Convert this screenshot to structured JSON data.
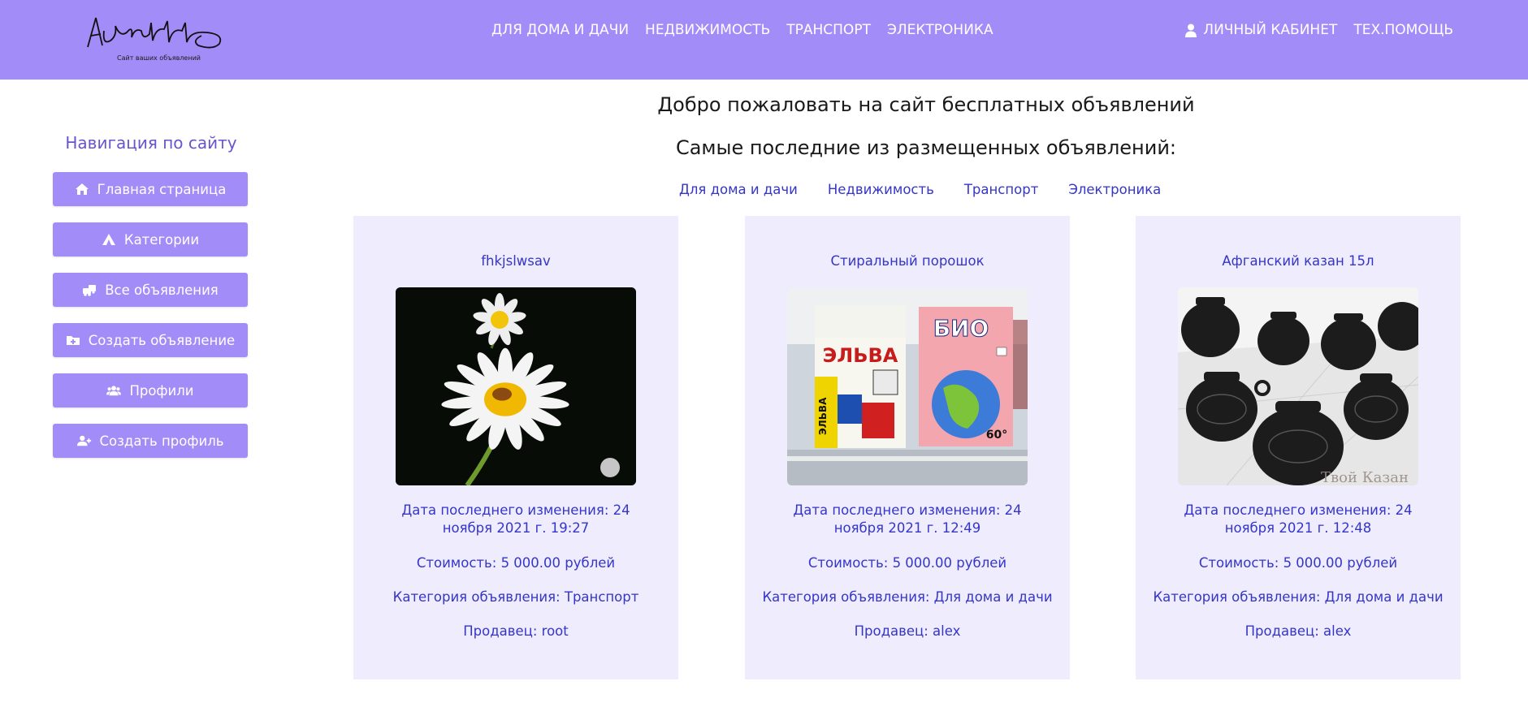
{
  "header": {
    "logo_text": "Avito",
    "logo_tagline": "Сайт ваших объявлений",
    "nav": [
      "ДЛЯ ДОМА И ДАЧИ",
      "НЕДВИЖИМОСТЬ",
      "ТРАНСПОРТ",
      "ЭЛЕКТРОНИКА"
    ],
    "account_label": "ЛИЧНЫЙ КАБИНЕТ",
    "help_label": "ТЕХ.ПОМОЩЬ"
  },
  "sidebar": {
    "title": "Навигация по сайту",
    "items": [
      {
        "label": "Главная страница",
        "icon": "home-icon"
      },
      {
        "label": "Категории",
        "icon": "tent-icon"
      },
      {
        "label": "Все объявления",
        "icon": "vehicles-icon"
      },
      {
        "label": "Создать объявление",
        "icon": "folder-plus-icon"
      },
      {
        "label": "Профили",
        "icon": "users-icon"
      },
      {
        "label": "Создать профиль",
        "icon": "user-plus-icon"
      }
    ]
  },
  "main": {
    "welcome": "Добро пожаловать на сайт бесплатных объявлений",
    "latest": "Самые последние из размещенных объявлений:",
    "categories": [
      "Для дома и дачи",
      "Недвижимость",
      "Транспорт",
      "Электроника"
    ]
  },
  "cards": [
    {
      "title": "fhkjslwsav",
      "image": "daisy-flower-photo",
      "date": "Дата последнего изменения: 24 ноября 2021 г. 19:27",
      "price": "Стоимость: 5 000.00 рублей",
      "category": "Категория объявления: Транспорт",
      "seller": "Продавец: root"
    },
    {
      "title": "Стиральный порошок",
      "image": "detergent-boxes-photo",
      "date": "Дата последнего изменения: 24 ноября 2021 г. 12:49",
      "price": "Стоимость: 5 000.00 рублей",
      "category": "Категория объявления: Для дома и дачи",
      "seller": "Продавец: alex"
    },
    {
      "title": "Афганский казан 15л",
      "image": "cast-iron-kazans-photo",
      "watermark": "Твой Казан",
      "date": "Дата последнего изменения: 24 ноября 2021 г. 12:48",
      "price": "Стоимость: 5 000.00 рублей",
      "category": "Категория объявления: Для дома и дачи",
      "seller": "Продавец: alex"
    }
  ],
  "colors": {
    "header": "#a28cf7",
    "button": "#a28cf7",
    "card": "#efedfd",
    "link": "#3535c9",
    "sidebar_title": "#6655cc"
  }
}
